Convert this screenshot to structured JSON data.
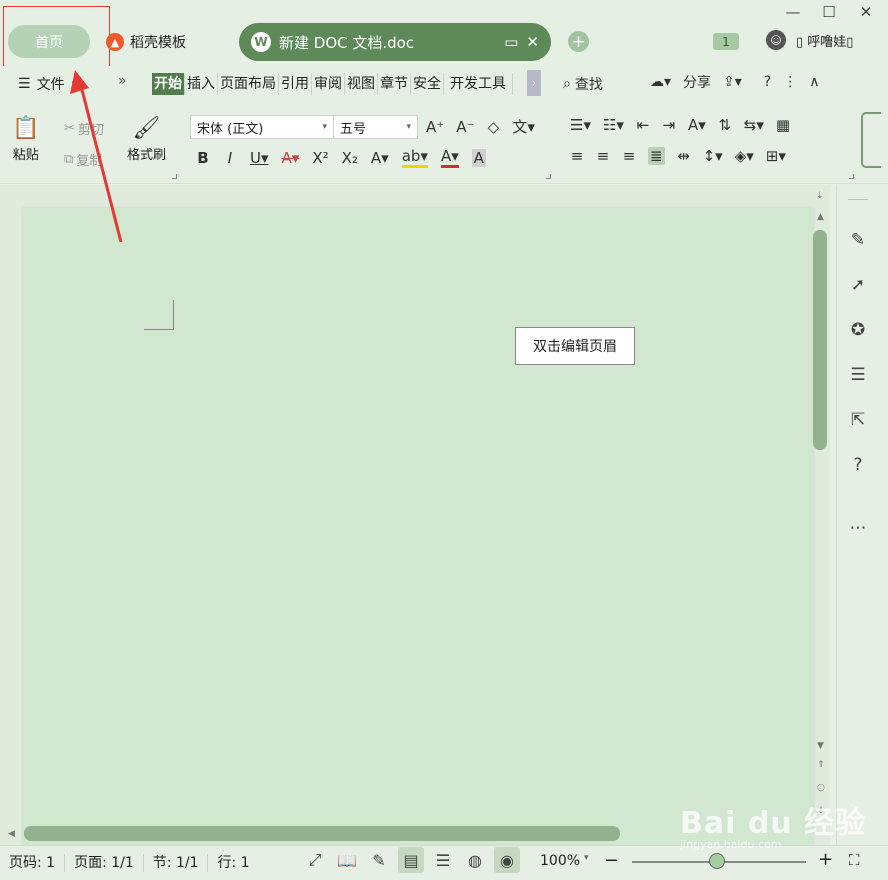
{
  "tabs": {
    "home": "首页",
    "template": "稻壳模板",
    "document": "新建 DOC 文档.doc",
    "badge_count": "1",
    "user_name": "▯ 呼噜娃▯"
  },
  "menu": {
    "file": "文件",
    "items": [
      "开始",
      "插入",
      "页面布局",
      "引用",
      "审阅",
      "视图",
      "章节",
      "安全",
      "开发工具"
    ],
    "search": "查找",
    "share": "分享"
  },
  "ribbon": {
    "paste": "粘贴",
    "cut": "剪切",
    "copy": "复制",
    "format_painter": "格式刷",
    "font_name": "宋体 (正文)",
    "font_size": "五号"
  },
  "document": {
    "header_tooltip": "双击编辑页眉"
  },
  "status": {
    "page_code": "页码: 1",
    "page": "页面: 1/1",
    "section": "节: 1/1",
    "line": "行: 1",
    "zoom": "100%"
  },
  "watermark": {
    "main": "Bai du 经验",
    "sub": "jingyan.baidu.com"
  },
  "colors": {
    "accent": "#5e8a5a",
    "page": "#d1e7d0",
    "annotation": "#e53935"
  }
}
